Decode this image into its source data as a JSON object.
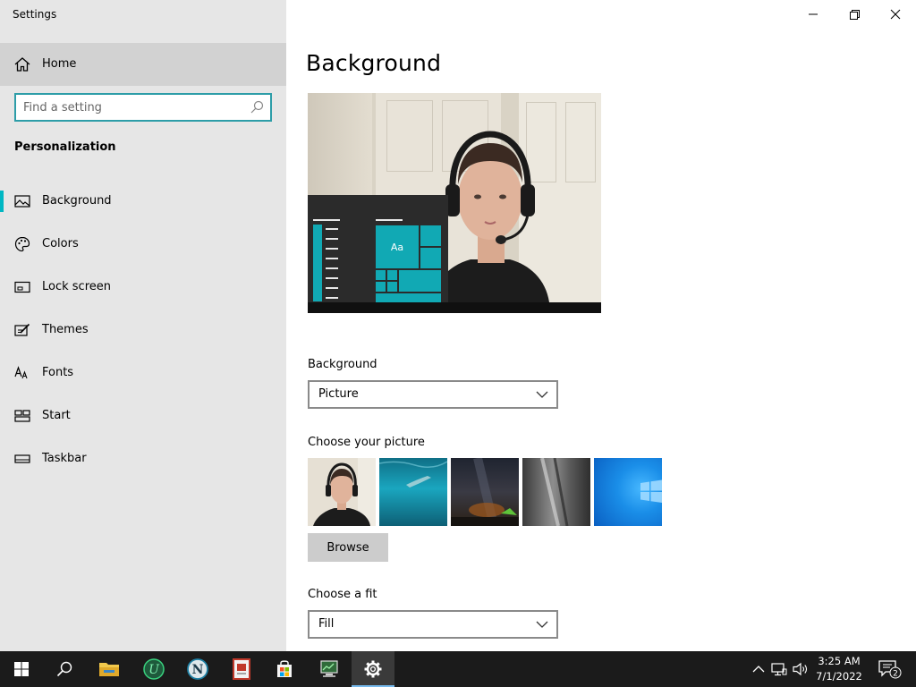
{
  "window": {
    "app_title": "Settings"
  },
  "sidebar": {
    "home_label": "Home",
    "search_placeholder": "Find a setting",
    "section_title": "Personalization",
    "items": [
      {
        "label": "Background",
        "icon": "picture-icon",
        "active": true
      },
      {
        "label": "Colors",
        "icon": "palette-icon"
      },
      {
        "label": "Lock screen",
        "icon": "lock-screen-icon"
      },
      {
        "label": "Themes",
        "icon": "themes-brush-icon"
      },
      {
        "label": "Fonts",
        "icon": "fonts-icon"
      },
      {
        "label": "Start",
        "icon": "start-layout-icon"
      },
      {
        "label": "Taskbar",
        "icon": "taskbar-icon"
      }
    ]
  },
  "main": {
    "page_title": "Background",
    "preview_tile_label": "Aa",
    "background_label": "Background",
    "background_value": "Picture",
    "choose_picture_label": "Choose your picture",
    "browse_label": "Browse",
    "choose_fit_label": "Choose a fit",
    "fit_value": "Fill"
  },
  "taskbar": {
    "time": "3:25 AM",
    "date": "7/1/2022",
    "notification_count": "2"
  },
  "colors": {
    "accent": "#00b7c3",
    "tile": "#11a9b4",
    "sidebar_bg": "#e6e6e6",
    "taskbar_bg": "#1b1b1b"
  }
}
